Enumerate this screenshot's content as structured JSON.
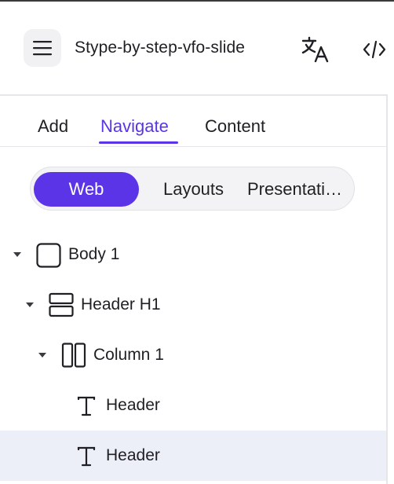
{
  "header": {
    "file_title": "Stype-by-step-vfo-slide",
    "icons": [
      "menu-icon",
      "translate-icon",
      "code-icon"
    ]
  },
  "tabs": [
    {
      "label": "Add",
      "active": false
    },
    {
      "label": "Navigate",
      "active": true
    },
    {
      "label": "Content",
      "active": false
    }
  ],
  "view_switch": [
    {
      "label": "Web",
      "active": true
    },
    {
      "label": "Layouts",
      "active": false
    },
    {
      "label": "Presentati…",
      "active": false
    }
  ],
  "tree": [
    {
      "label": "Body 1",
      "icon": "box-icon",
      "expanded": true,
      "selected": false
    },
    {
      "label": "Header H1",
      "icon": "rows-icon",
      "expanded": true,
      "selected": false
    },
    {
      "label": "Column 1",
      "icon": "columns-icon",
      "expanded": true,
      "selected": false
    },
    {
      "label": "Header",
      "icon": "text-icon",
      "expanded": false,
      "selected": false
    },
    {
      "label": "Header",
      "icon": "text-icon",
      "expanded": false,
      "selected": true
    }
  ],
  "colors": {
    "accent": "#5b34e8",
    "selected_row": "#eceef8",
    "text": "#1f1f24"
  }
}
